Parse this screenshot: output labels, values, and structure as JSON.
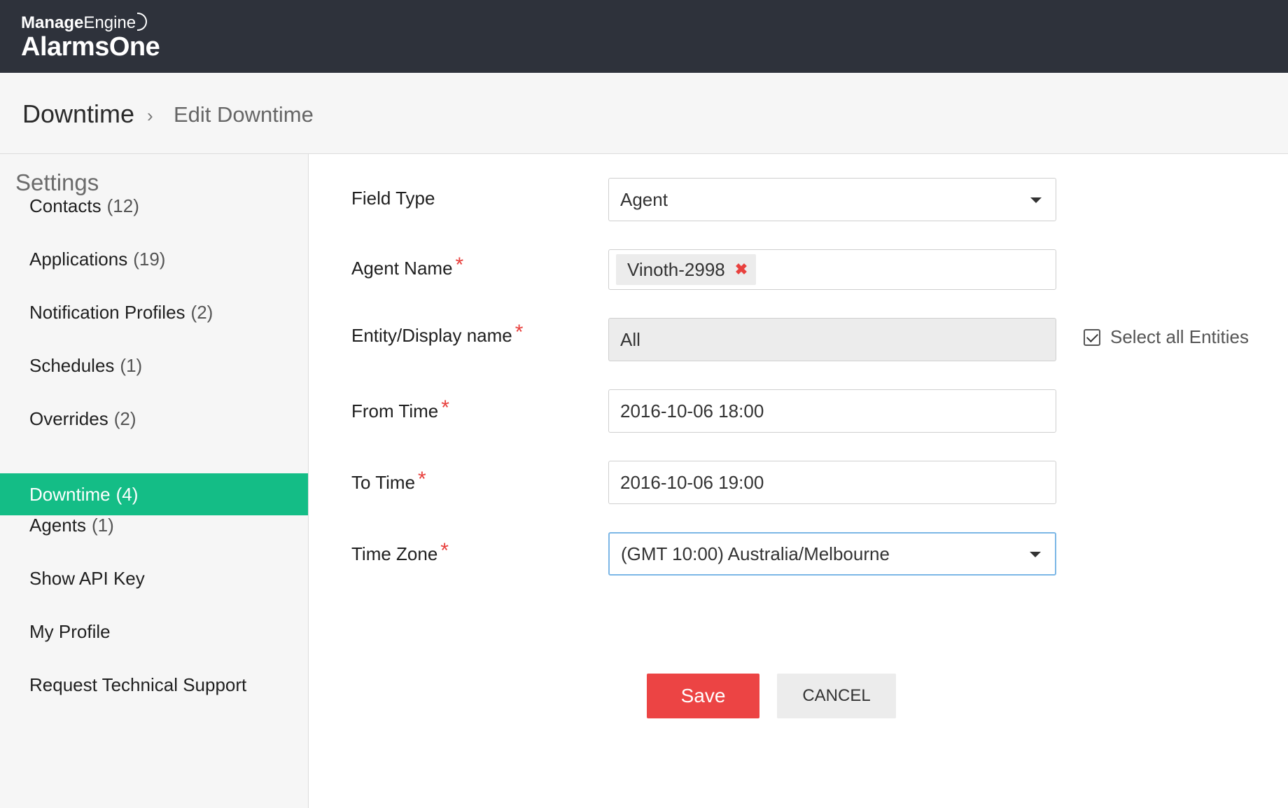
{
  "app": {
    "brand_top_bold": "Manage",
    "brand_top_light": "Engine",
    "brand_name": "AlarmsOne"
  },
  "breadcrumb": {
    "root": "Downtime",
    "separator": "›",
    "current": "Edit Downtime"
  },
  "sidebar": {
    "title": "Settings",
    "items": [
      {
        "label": "Contacts",
        "count": "(12)"
      },
      {
        "label": "Applications",
        "count": "(19)"
      },
      {
        "label": "Notification Profiles",
        "count": "(2)"
      },
      {
        "label": "Schedules",
        "count": "(1)"
      },
      {
        "label": "Overrides",
        "count": "(2)"
      },
      {
        "label": "Downtime",
        "count": "(4)",
        "active": true
      },
      {
        "label": "Agents",
        "count": "(1)"
      },
      {
        "label": "Show API Key",
        "count": ""
      },
      {
        "label": "My Profile",
        "count": ""
      },
      {
        "label": "Request Technical Support",
        "count": ""
      }
    ]
  },
  "form": {
    "required_mark": "*",
    "field_type": {
      "label": "Field Type",
      "value": "Agent"
    },
    "agent_name": {
      "label": "Agent Name",
      "tag": "Vinoth-2998",
      "remove_glyph": "✖"
    },
    "entity": {
      "label": "Entity/Display name",
      "value": "All",
      "select_all_label": "Select all Entities",
      "select_all_checked": true
    },
    "from_time": {
      "label": "From Time",
      "value": "2016-10-06 18:00"
    },
    "to_time": {
      "label": "To Time",
      "value": "2016-10-06 19:00"
    },
    "time_zone": {
      "label": "Time Zone",
      "value": "(GMT 10:00) Australia/Melbourne"
    }
  },
  "actions": {
    "save_label": "Save",
    "cancel_label": "CANCEL"
  },
  "colors": {
    "header_bg": "#2e323b",
    "active_nav": "#14bd86",
    "save_button": "#ec4444",
    "required": "#e8413e"
  }
}
